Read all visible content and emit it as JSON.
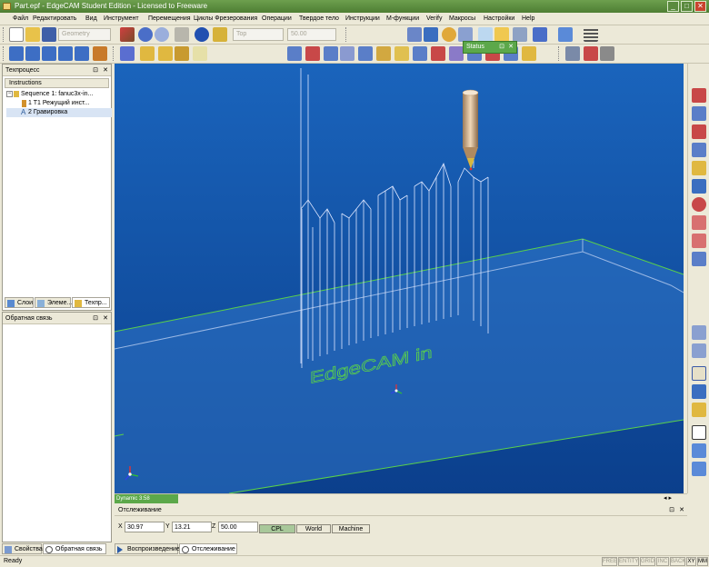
{
  "window": {
    "title": "Part.epf - EdgeCAM Student Edition - Licensed to Freeware",
    "min": "_",
    "max": "□",
    "close": "✕"
  },
  "menu": [
    "Файл",
    "Редактировать",
    "Вид",
    "Инструмент",
    "Перемещения",
    "Циклы Фрезерования",
    "Операции",
    "Твердое тело",
    "Инструкции",
    "М-функции",
    "Verify",
    "Макросы",
    "Настройки",
    "Help"
  ],
  "toolbar1": {
    "geometry_field": "Geometry",
    "view_field": "Top",
    "depth_field": "50.00"
  },
  "status_popup": {
    "title": "Status",
    "pin": "⊡",
    "close": "✕"
  },
  "left_panel": {
    "title": "Техпроцесс",
    "tree_header": "Instructions",
    "tree": [
      {
        "label": "Sequence 1: fanuc3x-in..."
      },
      {
        "label": "1 T1 Режущий инст..."
      },
      {
        "label": "2 Гравировка"
      }
    ],
    "tabs": [
      "Слои",
      "Элеме...",
      "Техпр..."
    ]
  },
  "feedback_panel": {
    "title": "Обратная связь"
  },
  "bottom_left_tabs": [
    "Свойства",
    "Обратная связь"
  ],
  "viewport": {
    "status_text": "Dynamic 3:58",
    "engraving_text": "EdgeCAM in",
    "colors": {
      "bg_top": "#1460b8",
      "bg_bottom": "#0a3f8a",
      "wire": "#dde6ff",
      "green": "#5ad14a"
    }
  },
  "tracking": {
    "title": "Отслеживание",
    "x_label": "X",
    "x_value": "30.97",
    "y_label": "Y",
    "y_value": "13.21",
    "z_label": "Z",
    "z_value": "50.00",
    "modes": [
      "CPL",
      "World",
      "Machine"
    ],
    "tabs": [
      "Воспроизведение",
      "Отслеживание"
    ]
  },
  "statusbar": {
    "text": "Ready",
    "indicators": [
      "FREE",
      "ENTITY",
      "GRID",
      "INC",
      "BACK",
      "XY",
      "MM"
    ]
  }
}
